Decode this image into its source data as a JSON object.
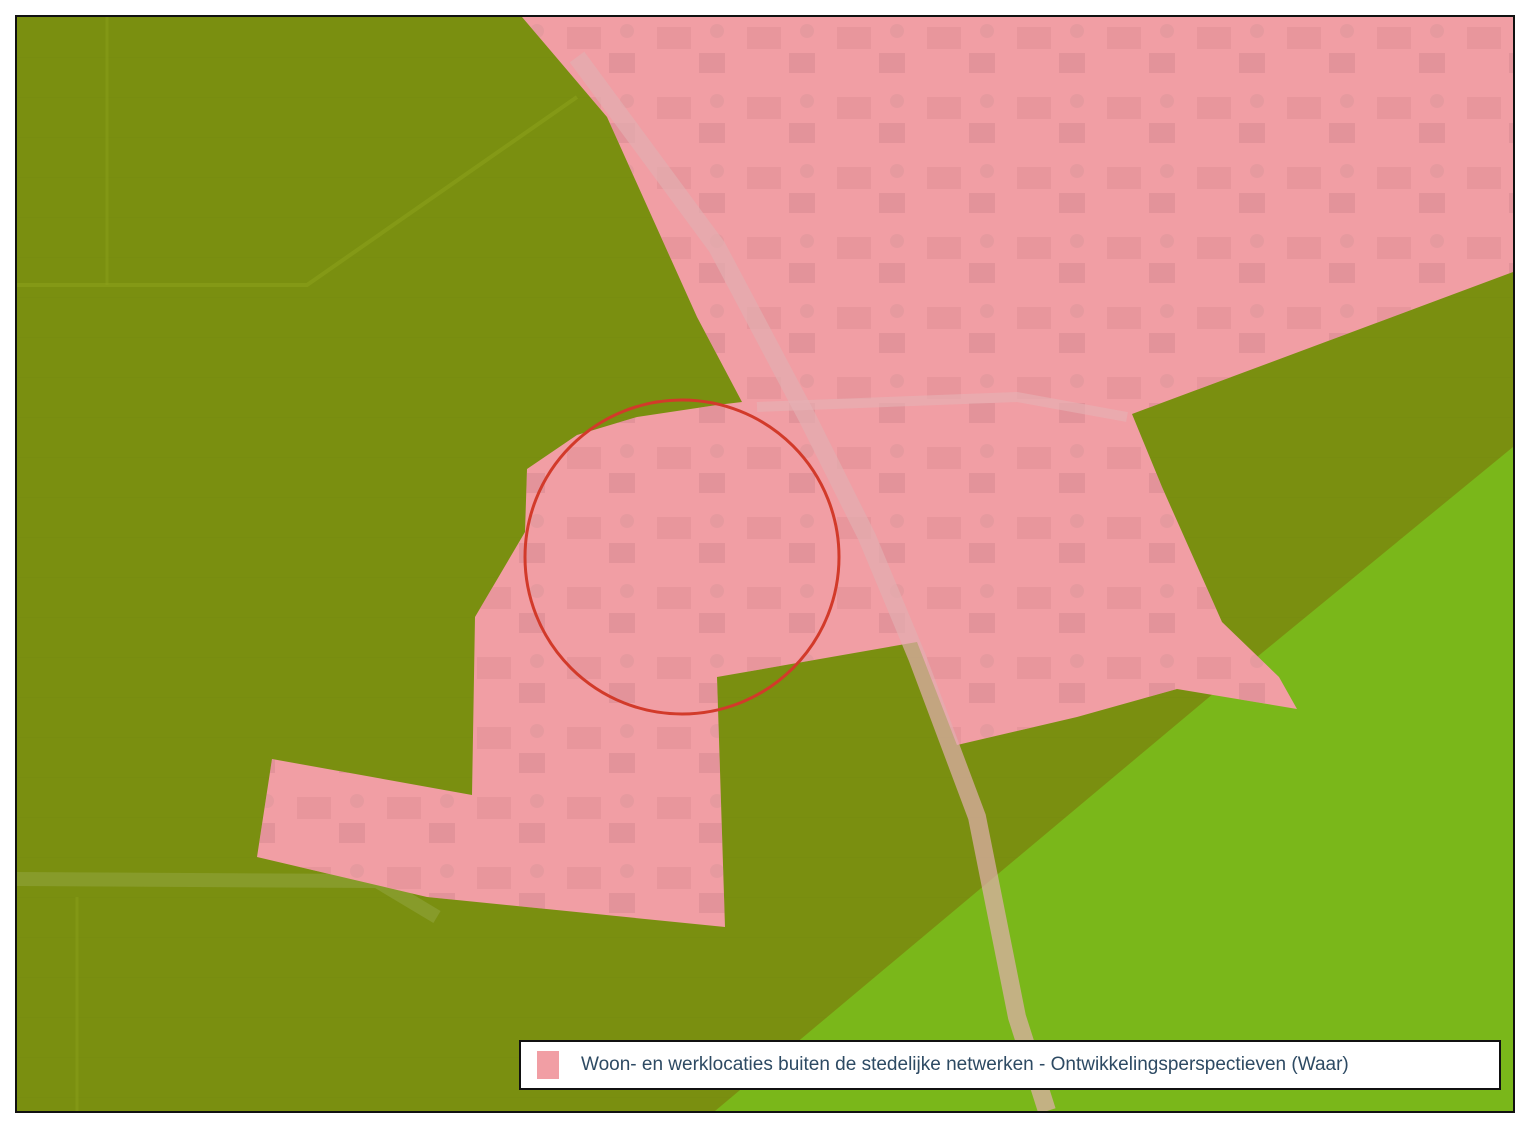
{
  "map": {
    "colors": {
      "background_green": "#7a8f10",
      "light_green": "#7ab71a",
      "residential_pink": "#f19ea4",
      "circle_outline": "#d23a2a"
    },
    "marker": "red-circle-outline"
  },
  "legend": {
    "items": [
      {
        "swatch_color": "#f19ea4",
        "label": "Woon- en werklocaties buiten de stedelijke netwerken - Ontwikkelingsperspectieven (Waar)"
      }
    ]
  }
}
